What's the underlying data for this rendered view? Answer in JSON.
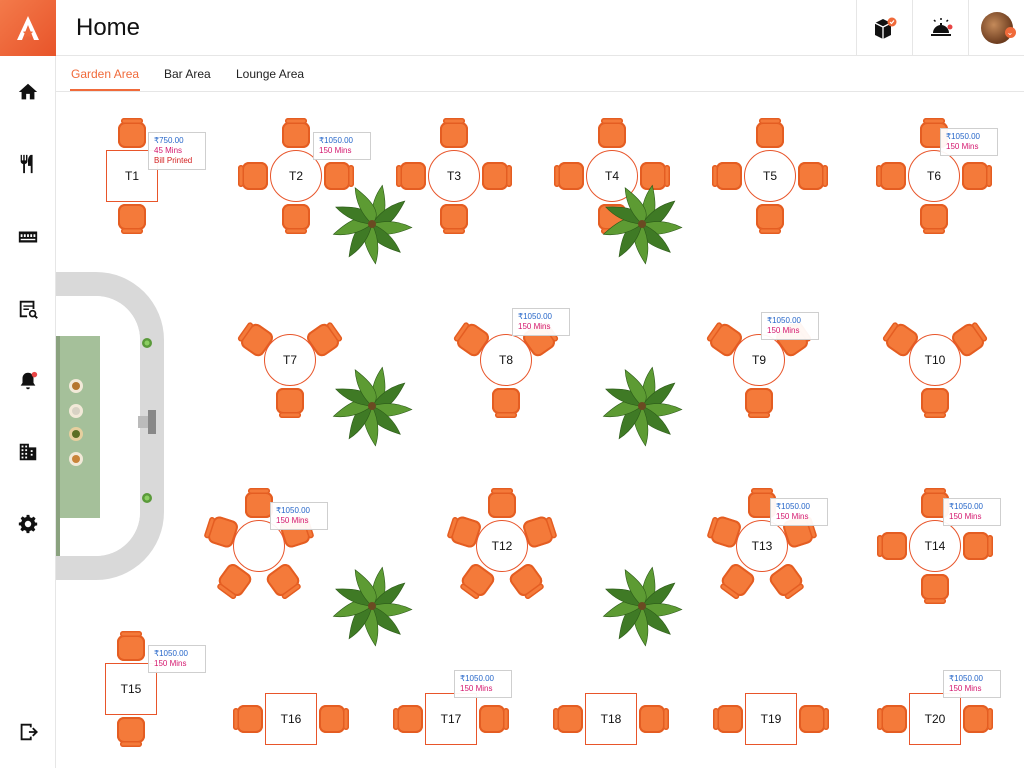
{
  "app": {
    "logo_letter": "A"
  },
  "header": {
    "title": "Home"
  },
  "sidebar": {
    "items": [
      {
        "name": "home-icon"
      },
      {
        "name": "fork-knife-icon"
      },
      {
        "name": "ticket-icon"
      },
      {
        "name": "receipt-search-icon"
      },
      {
        "name": "bell-icon"
      },
      {
        "name": "building-icon"
      },
      {
        "name": "gear-icon"
      }
    ],
    "logout": {
      "name": "logout-icon"
    }
  },
  "tabs": [
    {
      "label": "Garden Area",
      "active": true
    },
    {
      "label": "Bar Area",
      "active": false
    },
    {
      "label": "Lounge Area",
      "active": false
    }
  ],
  "colors": {
    "accent": "#f06a3a",
    "chair": "#f47a3a",
    "amount": "#2767c9",
    "minutes": "#d4176e",
    "bill": "#d32222"
  },
  "tables": [
    {
      "id": "T1",
      "label": "T1",
      "amount": "₹750.00",
      "mins": "45 Mins",
      "status": "Bill Printed"
    },
    {
      "id": "T2",
      "label": "T2",
      "amount": "₹1050.00",
      "mins": "150 Mins"
    },
    {
      "id": "T3",
      "label": "T3"
    },
    {
      "id": "T4",
      "label": "T4"
    },
    {
      "id": "T5",
      "label": "T5"
    },
    {
      "id": "T6",
      "label": "T6",
      "amount": "₹1050.00",
      "mins": "150 Mins"
    },
    {
      "id": "T7",
      "label": "T7"
    },
    {
      "id": "T8",
      "label": "T8",
      "amount": "₹1050.00",
      "mins": "150 Mins"
    },
    {
      "id": "T9",
      "label": "T9",
      "amount": "₹1050.00",
      "mins": "150 Mins"
    },
    {
      "id": "T10",
      "label": "T10"
    },
    {
      "id": "T11",
      "label": "",
      "amount": "₹1050.00",
      "mins": "150 Mins"
    },
    {
      "id": "T12",
      "label": "T12"
    },
    {
      "id": "T13",
      "label": "T13",
      "amount": "₹1050.00",
      "mins": "150 Mins"
    },
    {
      "id": "T14",
      "label": "T14",
      "amount": "₹1050.00",
      "mins": "150 Mins"
    },
    {
      "id": "T15",
      "label": "T15",
      "amount": "₹1050.00",
      "mins": "150 Mins"
    },
    {
      "id": "T16",
      "label": "T16"
    },
    {
      "id": "T17",
      "label": "T17",
      "amount": "₹1050.00",
      "mins": "150 Mins"
    },
    {
      "id": "T18",
      "label": "T18"
    },
    {
      "id": "T19",
      "label": "T19"
    },
    {
      "id": "T20",
      "label": "T20",
      "amount": "₹1050.00",
      "mins": "150 Mins"
    }
  ]
}
